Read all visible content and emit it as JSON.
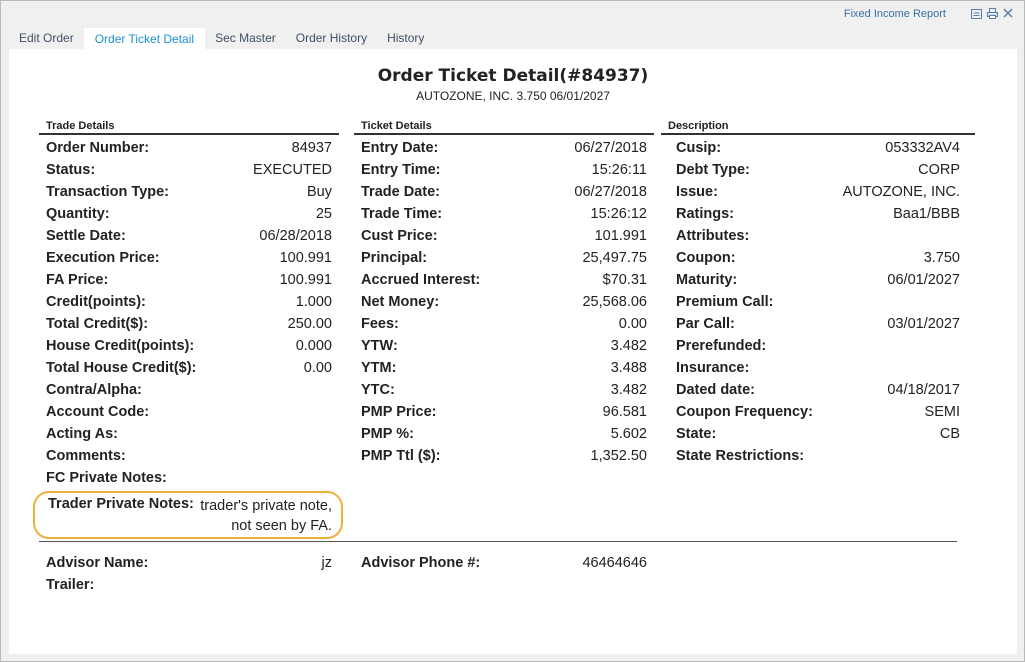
{
  "header": {
    "report_link": "Fixed Income Report"
  },
  "tabs": [
    {
      "label": "Edit Order"
    },
    {
      "label": "Order Ticket Detail"
    },
    {
      "label": "Sec Master"
    },
    {
      "label": "Order History"
    },
    {
      "label": "History"
    }
  ],
  "ticket": {
    "title": "Order Ticket Detail(#84937)",
    "subtitle": "AUTOZONE, INC. 3.750 06/01/2027"
  },
  "trade": {
    "heading": "Trade Details",
    "rows": [
      {
        "label": "Order Number:",
        "value": "84937"
      },
      {
        "label": "Status:",
        "value": "EXECUTED"
      },
      {
        "label": "Transaction Type:",
        "value": "Buy"
      },
      {
        "label": "Quantity:",
        "value": "25"
      },
      {
        "label": "Settle Date:",
        "value": "06/28/2018"
      },
      {
        "label": "Execution Price:",
        "value": "100.991"
      },
      {
        "label": "FA Price:",
        "value": "100.991"
      },
      {
        "label": "Credit(points):",
        "value": "1.000"
      },
      {
        "label": "Total Credit($):",
        "value": "250.00"
      },
      {
        "label": "House Credit(points):",
        "value": "0.000"
      },
      {
        "label": "Total House Credit($):",
        "value": "0.00"
      },
      {
        "label": "Contra/Alpha:",
        "value": ""
      },
      {
        "label": "Account Code:",
        "value": ""
      },
      {
        "label": "Acting As:",
        "value": ""
      },
      {
        "label": "Comments:",
        "value": ""
      },
      {
        "label": "FC Private Notes:",
        "value": ""
      }
    ],
    "trader_notes_label": "Trader Private Notes:",
    "trader_notes_value": "trader's private note, not seen by FA."
  },
  "ticket_details": {
    "heading": "Ticket Details",
    "rows": [
      {
        "label": "Entry Date:",
        "value": "06/27/2018"
      },
      {
        "label": "Entry Time:",
        "value": "15:26:11"
      },
      {
        "label": "Trade Date:",
        "value": "06/27/2018"
      },
      {
        "label": "Trade Time:",
        "value": "15:26:12"
      },
      {
        "label": "Cust Price:",
        "value": "101.991"
      },
      {
        "label": "Principal:",
        "value": "25,497.75"
      },
      {
        "label": "Accrued Interest:",
        "value": "$70.31"
      },
      {
        "label": "Net Money:",
        "value": "25,568.06"
      },
      {
        "label": "Fees:",
        "value": "0.00"
      },
      {
        "label": "YTW:",
        "value": "3.482"
      },
      {
        "label": "YTM:",
        "value": "3.488"
      },
      {
        "label": "YTC:",
        "value": "3.482"
      },
      {
        "label": "PMP Price:",
        "value": "96.581"
      },
      {
        "label": "PMP %:",
        "value": "5.602"
      },
      {
        "label": "PMP Ttl ($):",
        "value": "1,352.50"
      }
    ]
  },
  "description": {
    "heading": "Description",
    "rows": [
      {
        "label": "Cusip:",
        "value": "053332AV4"
      },
      {
        "label": "Debt Type:",
        "value": "CORP"
      },
      {
        "label": "Issue:",
        "value": "AUTOZONE, INC."
      },
      {
        "label": "Ratings:",
        "value": "Baa1/BBB"
      },
      {
        "label": "Attributes:",
        "value": ""
      },
      {
        "label": "Coupon:",
        "value": "3.750"
      },
      {
        "label": "Maturity:",
        "value": "06/01/2027"
      },
      {
        "label": "Premium Call:",
        "value": ""
      },
      {
        "label": "Par Call:",
        "value": "03/01/2027"
      },
      {
        "label": "Prerefunded:",
        "value": ""
      },
      {
        "label": "Insurance:",
        "value": ""
      },
      {
        "label": "Dated date:",
        "value": "04/18/2017"
      },
      {
        "label": "Coupon Frequency:",
        "value": "SEMI"
      },
      {
        "label": "State:",
        "value": "CB"
      },
      {
        "label": "State Restrictions:",
        "value": ""
      }
    ]
  },
  "advisor": {
    "name_label": "Advisor Name:",
    "name_value": "jz",
    "trailer_label": "Trailer:",
    "trailer_value": "",
    "phone_label": "Advisor Phone #:",
    "phone_value": "46464646"
  },
  "colors": {
    "active_tab": "#1d8fd6",
    "highlight": "#f0b03c"
  },
  "icons": [
    "report-icon",
    "print-icon",
    "close-icon"
  ]
}
